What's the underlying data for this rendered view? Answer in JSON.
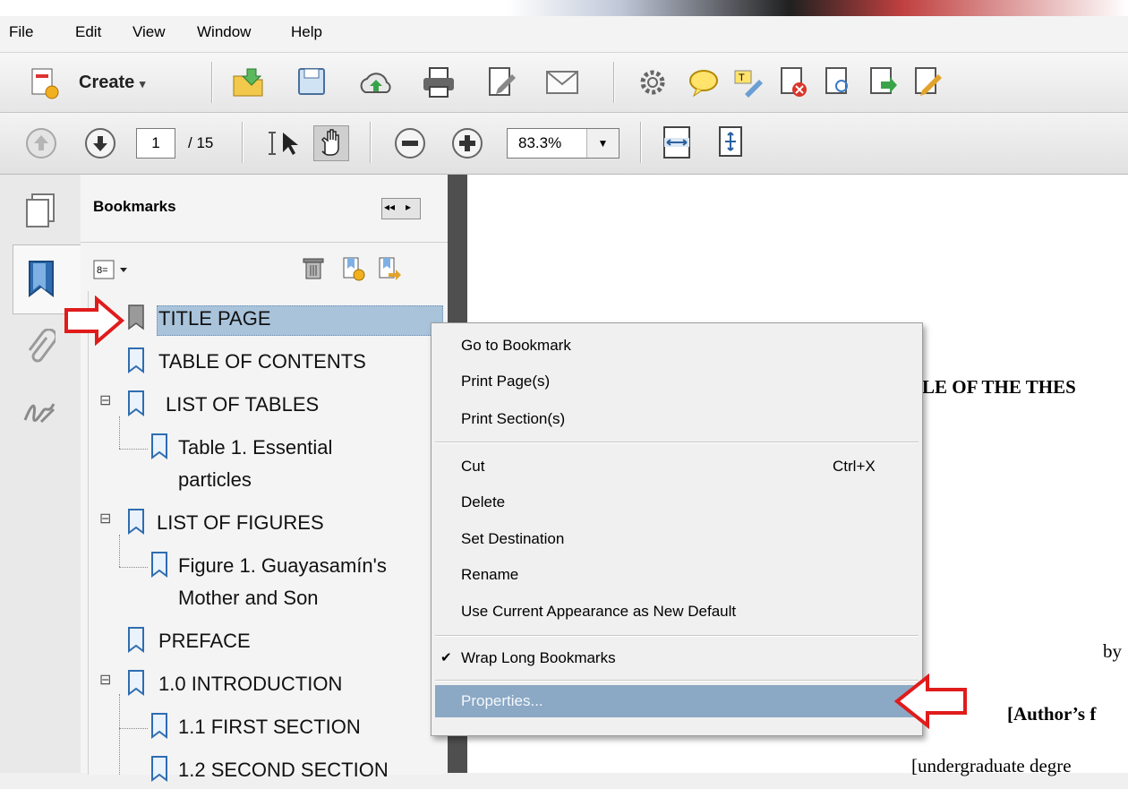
{
  "menu": {
    "file": "File",
    "edit": "Edit",
    "view": "View",
    "window": "Window",
    "help": "Help"
  },
  "toolbar": {
    "create_label": "Create",
    "create_arrow": "▾"
  },
  "nav": {
    "page_current": "1",
    "page_total": "/ 15",
    "zoom_value": "83.3%"
  },
  "panel": {
    "title": "Bookmarks"
  },
  "bookmarks": [
    {
      "label": "TITLE PAGE",
      "selected": true
    },
    {
      "label": "TABLE OF CONTENTS"
    },
    {
      "label": "LIST OF TABLES",
      "expander": "⊟"
    },
    {
      "label": "Table 1. Essential",
      "label2": "particles"
    },
    {
      "label": "LIST OF FIGURES",
      "expander": "⊟"
    },
    {
      "label": "Figure 1. Guayasamín's",
      "label2": "Mother and Son"
    },
    {
      "label": "PREFACE"
    },
    {
      "label": "1.0  INTRODUCTION",
      "expander": "⊟"
    },
    {
      "label": "1.1 FIRST SECTION"
    },
    {
      "label": "1.2 SECOND SECTION"
    }
  ],
  "context_menu": {
    "items": [
      {
        "label": "Go to Bookmark",
        "ul": "G"
      },
      {
        "label": "Print Page(s)",
        "ul": "P"
      },
      {
        "label": "Print Section(s)",
        "ul": "S"
      },
      {
        "label": "Cut",
        "shortcut": "Ctrl+X",
        "ul": "t"
      },
      {
        "label": "Delete",
        "ul": "D"
      },
      {
        "label": "Set Destination",
        "ul": "a"
      },
      {
        "label": "Rename",
        "ul": "R"
      },
      {
        "label": "Use Current Appearance as New Default",
        "ul": "U"
      },
      {
        "label": "Wrap Long Bookmarks",
        "checked": "✔",
        "ul": "W"
      },
      {
        "label": "Properties...",
        "ul": "o",
        "highlighted": true
      }
    ]
  },
  "document": {
    "title_fragment": "LE OF THE THES",
    "by": "by",
    "author": "[Author’s f",
    "degree": "[undergraduate degre"
  },
  "colors": {
    "selection": "#a9c3db",
    "highlight": "#8ba8c4",
    "arrow": "#e01b1b",
    "divider": "#4f4f4f"
  },
  "icons": [
    "page-thumbnails-icon",
    "bookmarks-icon",
    "attachments-icon",
    "signatures-icon",
    "bookmark-options-icon",
    "delete-bookmark-icon",
    "new-bookmark-icon",
    "expand-bookmark-icon"
  ]
}
